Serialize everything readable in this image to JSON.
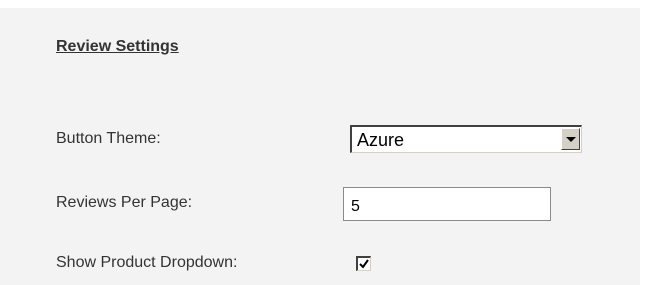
{
  "section": {
    "title": "Review Settings"
  },
  "fields": {
    "button_theme": {
      "label": "Button Theme:",
      "value": "Azure"
    },
    "reviews_per_page": {
      "label": "Reviews Per Page:",
      "value": "5"
    },
    "show_product_dropdown": {
      "label": "Show Product Dropdown:",
      "checked": true
    }
  },
  "icons": {
    "select_arrow": "chevron-down-icon",
    "checkbox_mark": "checkmark-icon"
  },
  "colors": {
    "panel_background": "#f3f3f3",
    "text": "#333333"
  }
}
